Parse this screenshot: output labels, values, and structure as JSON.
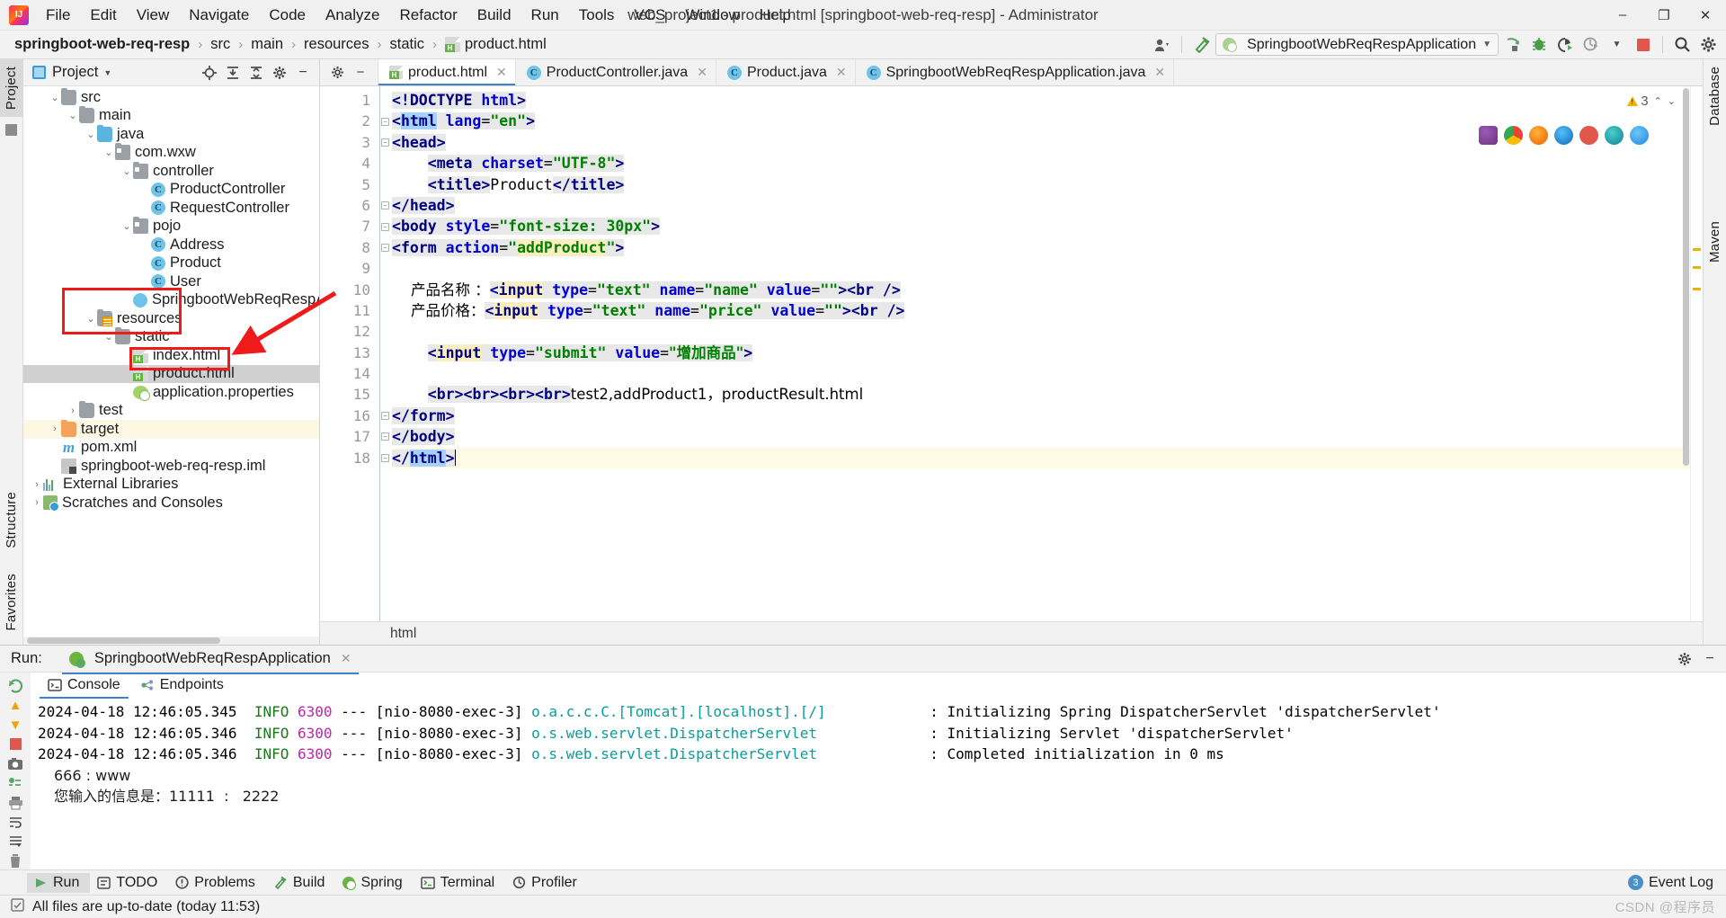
{
  "window": {
    "title": "web_project1 - product.html [springboot-web-req-resp] - Administrator",
    "minimize": "–",
    "maximize": "❐",
    "close": "✕"
  },
  "menu": {
    "items": [
      "File",
      "Edit",
      "View",
      "Navigate",
      "Code",
      "Analyze",
      "Refactor",
      "Build",
      "Run",
      "Tools",
      "VCS",
      "Window",
      "Help"
    ]
  },
  "breadcrumb": {
    "items": [
      "springboot-web-req-resp",
      "src",
      "main",
      "resources",
      "static",
      "product.html"
    ],
    "separator": "›"
  },
  "toolbar": {
    "run_config": "SpringbootWebReqRespApplication",
    "icons": [
      "user-avatar-icon",
      "hammer-build-icon",
      "run-icon",
      "debug-icon",
      "run-with-coverage-icon",
      "profiler-icon",
      "stop-icon",
      "search-everywhere-icon",
      "settings-icon"
    ]
  },
  "left_strip": {
    "tabs": [
      "Project"
    ]
  },
  "right_strip": {
    "tabs": [
      "Database",
      "Maven"
    ]
  },
  "bottom_strip": {
    "tabs": [
      "Structure",
      "Favorites"
    ]
  },
  "project_panel": {
    "title": "Project",
    "actions": [
      "locate-icon",
      "expand-all-icon",
      "collapse-all-icon",
      "gear-icon",
      "hide-icon"
    ],
    "tree": [
      {
        "label": "src",
        "icon": "folder-icon",
        "depth": 1,
        "arrow": "down"
      },
      {
        "label": "main",
        "icon": "folder-icon",
        "depth": 2,
        "arrow": "down"
      },
      {
        "label": "java",
        "icon": "folder-blue-icon",
        "depth": 3,
        "arrow": "down"
      },
      {
        "label": "com.wxw",
        "icon": "package-icon",
        "depth": 4,
        "arrow": "down"
      },
      {
        "label": "controller",
        "icon": "package-icon",
        "depth": 5,
        "arrow": "down"
      },
      {
        "label": "ProductController",
        "icon": "java-class-icon",
        "depth": 6,
        "arrow": "none"
      },
      {
        "label": "RequestController",
        "icon": "java-class-icon",
        "depth": 6,
        "arrow": "none"
      },
      {
        "label": "pojo",
        "icon": "package-icon",
        "depth": 5,
        "arrow": "down"
      },
      {
        "label": "Address",
        "icon": "java-class-icon",
        "depth": 6,
        "arrow": "none"
      },
      {
        "label": "Product",
        "icon": "java-class-icon",
        "depth": 6,
        "arrow": "none"
      },
      {
        "label": "User",
        "icon": "java-class-icon",
        "depth": 6,
        "arrow": "none"
      },
      {
        "label": "SpringbootWebReqRespApplic",
        "icon": "spring-class-icon",
        "depth": 5,
        "arrow": "none"
      },
      {
        "label": "resources",
        "icon": "resources-folder-icon",
        "depth": 3,
        "arrow": "down"
      },
      {
        "label": "static",
        "icon": "folder-icon",
        "depth": 4,
        "arrow": "down"
      },
      {
        "label": "index.html",
        "icon": "html-file-icon",
        "depth": 5,
        "arrow": "none"
      },
      {
        "label": "product.html",
        "icon": "html-file-icon",
        "depth": 5,
        "arrow": "none",
        "selected": true
      },
      {
        "label": "application.properties",
        "icon": "spring-properties-icon",
        "depth": 5,
        "arrow": "none"
      },
      {
        "label": "test",
        "icon": "folder-icon",
        "depth": 2,
        "arrow": "right"
      },
      {
        "label": "target",
        "icon": "folder-orange-icon",
        "depth": 1,
        "arrow": "right",
        "highlighted": true
      },
      {
        "label": "pom.xml",
        "icon": "maven-icon",
        "depth": 1,
        "arrow": "none"
      },
      {
        "label": "springboot-web-req-resp.iml",
        "icon": "iml-file-icon",
        "depth": 1,
        "arrow": "none"
      },
      {
        "label": "External Libraries",
        "icon": "libraries-icon",
        "depth": 0,
        "arrow": "right"
      },
      {
        "label": "Scratches and Consoles",
        "icon": "scratches-icon",
        "depth": 0,
        "arrow": "right"
      }
    ]
  },
  "editor": {
    "tabs": [
      {
        "label": "product.html",
        "icon": "html-file-icon",
        "active": true
      },
      {
        "label": "ProductController.java",
        "icon": "java-class-icon",
        "active": false
      },
      {
        "label": "Product.java",
        "icon": "java-class-icon",
        "active": false
      },
      {
        "label": "SpringbootWebReqRespApplication.java",
        "icon": "spring-class-icon",
        "active": false
      }
    ],
    "warning_count": "3",
    "bottom_breadcrumb": "html",
    "browser_icons": [
      "ie-icon",
      "chrome-icon",
      "firefox-icon",
      "edge-legacy-icon",
      "opera-icon",
      "edge-icon",
      "safari-icon"
    ],
    "lines": [
      {
        "n": "1"
      },
      {
        "n": "2"
      },
      {
        "n": "3"
      },
      {
        "n": "4"
      },
      {
        "n": "5"
      },
      {
        "n": "6"
      },
      {
        "n": "7"
      },
      {
        "n": "8"
      },
      {
        "n": "9"
      },
      {
        "n": "10"
      },
      {
        "n": "11"
      },
      {
        "n": "12"
      },
      {
        "n": "13"
      },
      {
        "n": "14"
      },
      {
        "n": "15"
      },
      {
        "n": "16"
      },
      {
        "n": "17"
      },
      {
        "n": "18"
      }
    ],
    "source_text": [
      "<!DOCTYPE html>",
      "<html lang=\"en\">",
      "<head>",
      "    <meta charset=\"UTF-8\">",
      "    <title>Product</title>",
      "</head>",
      "<body style=\"font-size: 30px\">",
      "<form action=\"addProduct\">",
      "",
      "    产品名称 ：<input type=\"text\" name=\"name\" value=\"\"><br />",
      "    产品价格：<input type=\"text\" name=\"price\" value=\"\"><br />",
      "",
      "    <input type=\"submit\" value=\"增加商品\">",
      "",
      "    <br><br><br><br>test2,addProduct1，productResult.html",
      "</form>",
      "</body>",
      "</html>"
    ]
  },
  "run_panel": {
    "label": "Run:",
    "tab": "SpringbootWebReqRespApplication",
    "console_tabs": [
      {
        "label": "Console",
        "icon": "console-icon",
        "active": true
      },
      {
        "label": "Endpoints",
        "icon": "endpoints-icon",
        "active": false
      }
    ],
    "side_actions": [
      "rerun-icon",
      "up-icon",
      "down-icon",
      "stop-icon",
      "camera-icon",
      "thread-dump-icon",
      "print-icon",
      "soft-wrap-icon",
      "scroll-to-end-icon",
      "trash-icon"
    ],
    "header_actions": [
      "settings-icon",
      "minimize-icon"
    ],
    "log_lines": [
      {
        "date": "2024-04-18 12:46:05.345",
        "level": "INFO",
        "pid": "6300",
        "dashes": "---",
        "thread": "[nio-8080-exec-3]",
        "logger": "o.a.c.c.C.[Tomcat].[localhost].[/]",
        "sep": ":",
        "message": "Initializing Spring DispatcherServlet 'dispatcherServlet'"
      },
      {
        "date": "2024-04-18 12:46:05.346",
        "level": "INFO",
        "pid": "6300",
        "dashes": "---",
        "thread": "[nio-8080-exec-3]",
        "logger": "o.s.web.servlet.DispatcherServlet",
        "sep": ":",
        "message": "Initializing Servlet 'dispatcherServlet'"
      },
      {
        "date": "2024-04-18 12:46:05.346",
        "level": "INFO",
        "pid": "6300",
        "dashes": "---",
        "thread": "[nio-8080-exec-3]",
        "logger": "o.s.web.servlet.DispatcherServlet",
        "sep": ":",
        "message": "Completed initialization in 0 ms"
      }
    ],
    "plain_lines": [
      "666 : www",
      "您输入的信息是：11111  :   2222"
    ]
  },
  "tool_strip": {
    "items": [
      {
        "label": "Run",
        "icon": "run-icon",
        "active": true
      },
      {
        "label": "TODO",
        "icon": "todo-icon",
        "active": false
      },
      {
        "label": "Problems",
        "icon": "problems-icon",
        "active": false
      },
      {
        "label": "Build",
        "icon": "build-icon",
        "active": false
      },
      {
        "label": "Spring",
        "icon": "spring-icon",
        "active": false
      },
      {
        "label": "Terminal",
        "icon": "terminal-icon",
        "active": false
      },
      {
        "label": "Profiler",
        "icon": "profiler-icon",
        "active": false
      }
    ],
    "event_log": {
      "label": "Event Log",
      "count": "3"
    }
  },
  "status_bar": {
    "message": "All files are up-to-date (today 11:53)",
    "watermark": "CSDN @程序员"
  }
}
